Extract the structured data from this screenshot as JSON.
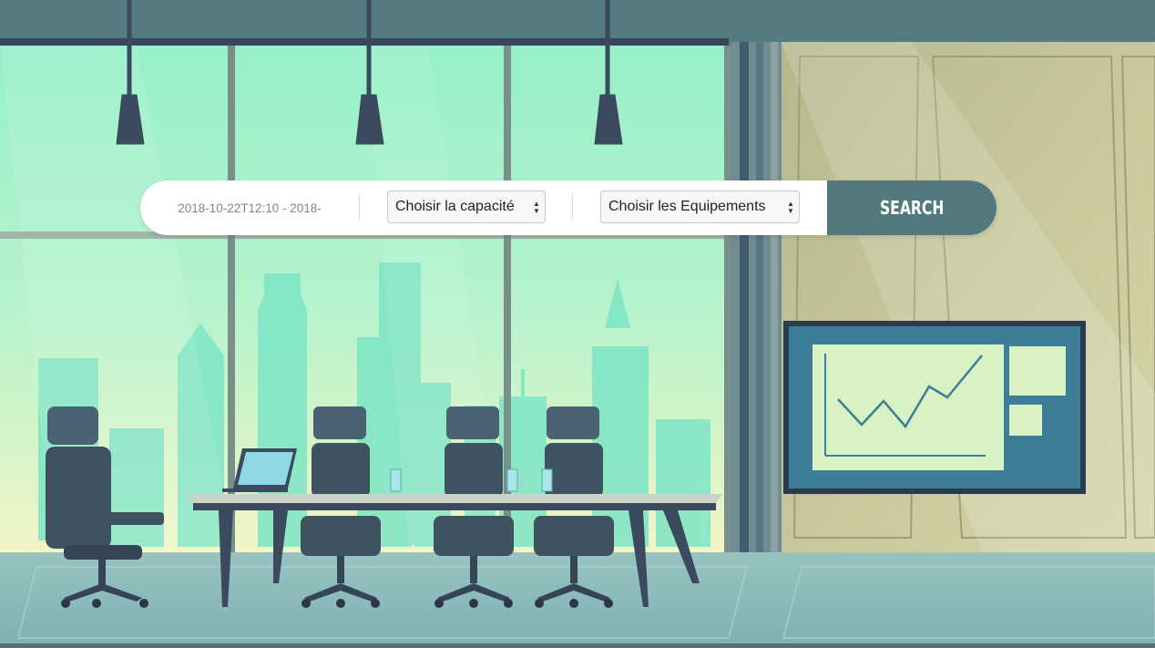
{
  "search": {
    "date_range_value": "2018-10-22T12:10 - 2018-",
    "capacity_select": {
      "selected": "Choisir la capacité"
    },
    "equipment_select": {
      "selected": "Choisir les Equipements"
    },
    "button_label": "SEARCH"
  },
  "colors": {
    "accent": "#52797d",
    "ceiling": "#537b80",
    "sky_top": "#93f2c7",
    "sky_bottom": "#f2f5c8",
    "city": "#6ee3c4",
    "wall": "#c8c99e",
    "floor": "#8bb9b9",
    "dark_furniture": "#39485a",
    "screen": "#3e7d97"
  },
  "icons": {
    "select_arrows": "up-down-arrows-icon"
  }
}
